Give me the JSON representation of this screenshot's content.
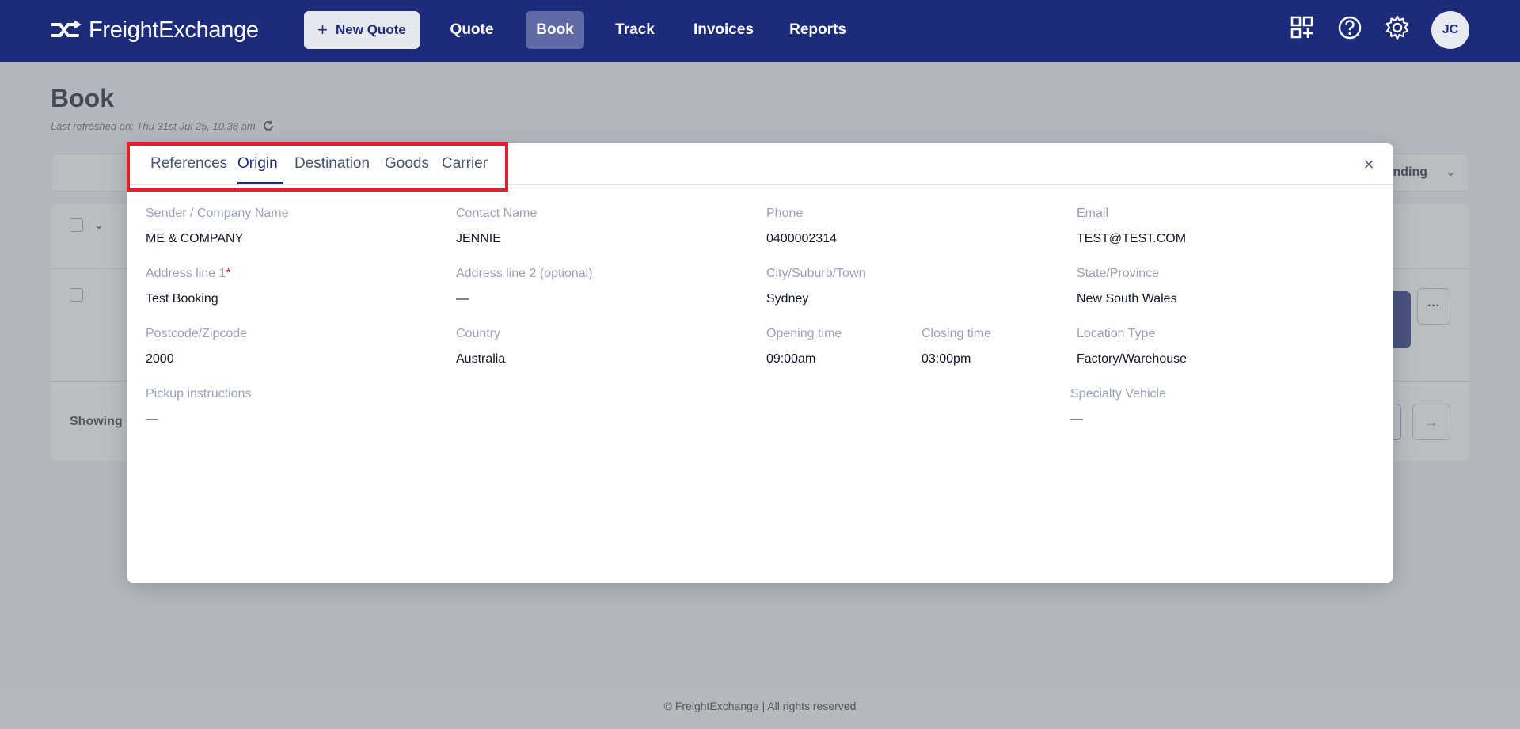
{
  "brand": {
    "name": "FreightExchange"
  },
  "nav": {
    "new_quote": "New Quote",
    "items": [
      {
        "label": "Quote"
      },
      {
        "label": "Book"
      },
      {
        "label": "Track"
      },
      {
        "label": "Invoices"
      },
      {
        "label": "Reports"
      }
    ],
    "active": "Book",
    "avatar_initials": "JC",
    "icons": [
      "apps-add-icon",
      "help-icon",
      "settings-icon"
    ]
  },
  "page": {
    "title": "Book",
    "last_refreshed": "Last refreshed on: Thu 31st Jul 25, 10:38 am",
    "filter_status": "ending",
    "pagination_label": "Showing",
    "footer": "© FreightExchange | All rights reserved"
  },
  "modal": {
    "tabs": [
      {
        "label": "References"
      },
      {
        "label": "Origin"
      },
      {
        "label": "Destination"
      },
      {
        "label": "Goods"
      },
      {
        "label": "Carrier"
      }
    ],
    "active_tab": "Origin",
    "fields": {
      "sender_company_label": "Sender / Company Name",
      "sender_company_value": "ME & COMPANY",
      "contact_name_label": "Contact Name",
      "contact_name_value": "JENNIE",
      "phone_label": "Phone",
      "phone_value": "0400002314",
      "email_label": "Email",
      "email_value": "TEST@TEST.COM",
      "address1_label": "Address line 1",
      "address1_required_mark": "*",
      "address1_value": "Test Booking",
      "address2_label": "Address line 2 (optional)",
      "address2_value": "—",
      "city_label": "City/Suburb/Town",
      "city_value": "Sydney",
      "state_label": "State/Province",
      "state_value": "New South Wales",
      "postcode_label": "Postcode/Zipcode",
      "postcode_value": "2000",
      "country_label": "Country",
      "country_value": "Australia",
      "opening_time_label": "Opening time",
      "opening_time_value": "09:00am",
      "closing_time_label": "Closing time",
      "closing_time_value": "03:00pm",
      "location_type_label": "Location Type",
      "location_type_value": "Factory/Warehouse",
      "pickup_instructions_label": "Pickup instructions",
      "pickup_instructions_value": "—",
      "specialty_vehicle_label": "Specialty Vehicle",
      "specialty_vehicle_value": "—"
    }
  },
  "colors": {
    "brand_navy": "#1c2b7a",
    "highlight_red": "#e0202a",
    "label_gray": "#98a1b8"
  }
}
